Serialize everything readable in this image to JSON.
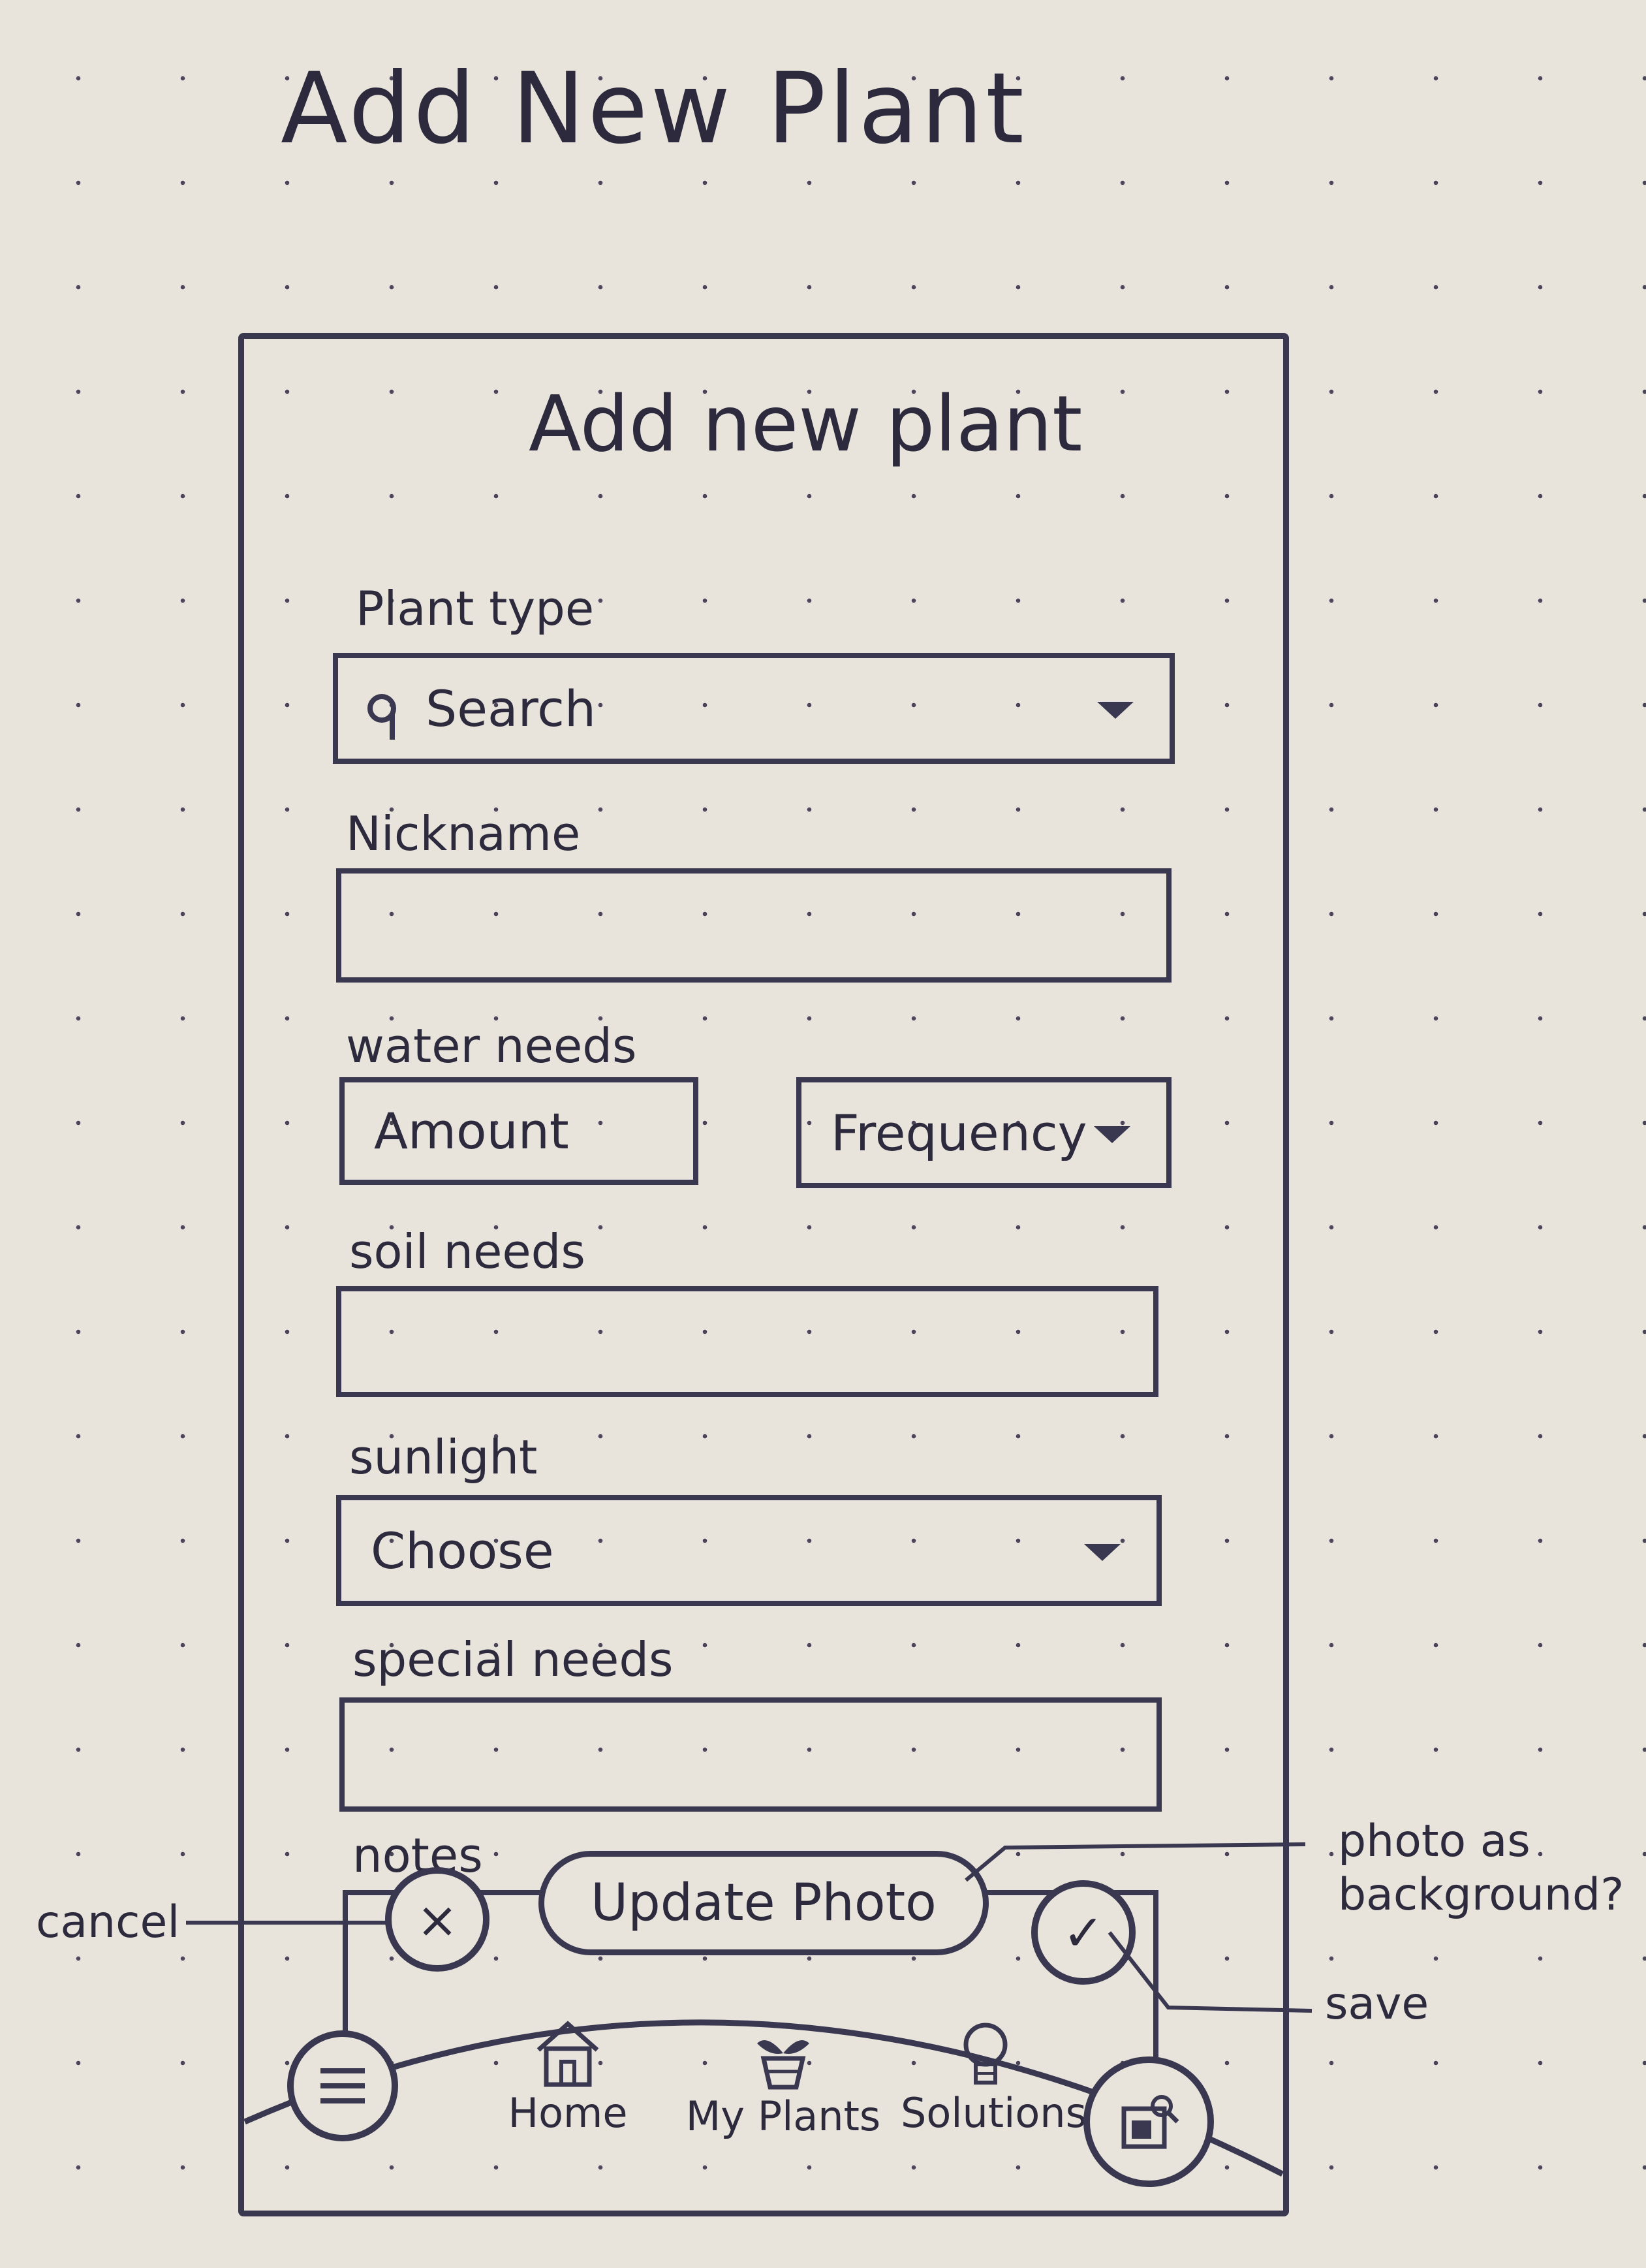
{
  "sketch_title": "Add New Plant",
  "screen": {
    "title": "Add new plant",
    "fields": {
      "plant_type": {
        "label": "Plant type",
        "placeholder": "Search"
      },
      "nickname": {
        "label": "Nickname",
        "value": ""
      },
      "water_needs": {
        "label": "water needs",
        "amount_placeholder": "Amount",
        "frequency_placeholder": "Frequency"
      },
      "soil_needs": {
        "label": "soil needs",
        "value": ""
      },
      "sunlight": {
        "label": "sunlight",
        "placeholder": "Choose"
      },
      "special_needs": {
        "label": "special needs",
        "value": ""
      },
      "notes": {
        "label": "notes"
      }
    },
    "actions": {
      "cancel_symbol": "×",
      "update_photo": "Update Photo",
      "save_symbol": "✓"
    },
    "nav": {
      "items": [
        {
          "label": "Home",
          "icon": "house-icon"
        },
        {
          "label": "My Plants",
          "icon": "potted-plant-icon"
        },
        {
          "label": "Solutions",
          "icon": "lightbulb-icon"
        }
      ],
      "menu_icon": "menu-icon",
      "right_icon": "photo-search-icon"
    }
  },
  "annotations": {
    "cancel": "cancel",
    "photo_background": "photo as background?",
    "save": "save"
  }
}
